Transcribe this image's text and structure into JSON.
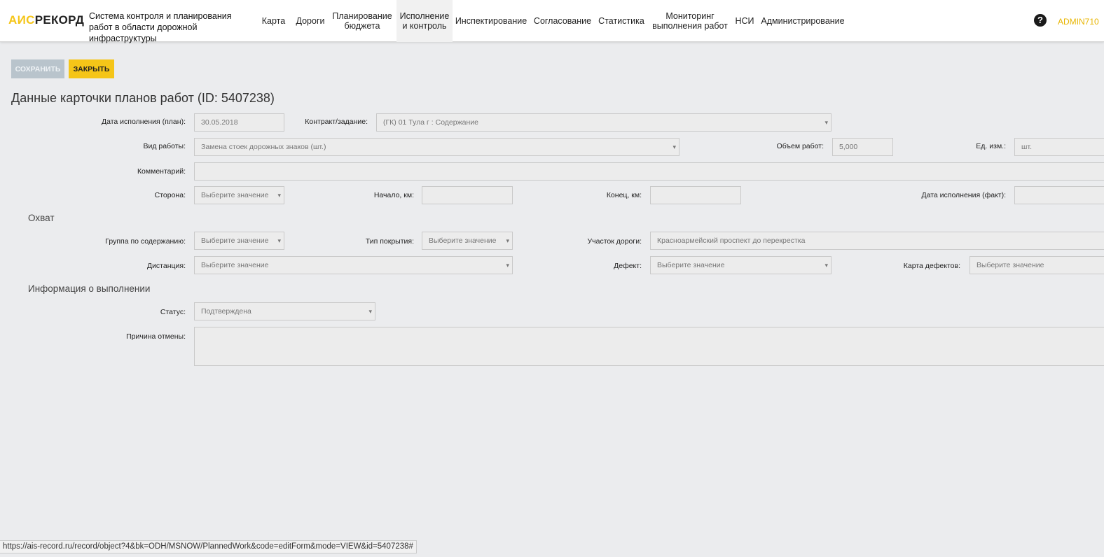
{
  "header": {
    "logo_part1": "АИС",
    "logo_part2": "РЕКОРД",
    "app_title": "Система контроля и планирования работ в области дорожной инфраструктуры",
    "nav": [
      {
        "label": "Карта"
      },
      {
        "label": "Дороги"
      },
      {
        "label": "Планирование\nбюджета"
      },
      {
        "label": "Исполнение\nи контроль",
        "active": true
      },
      {
        "label": "Инспектирование"
      },
      {
        "label": "Согласование"
      },
      {
        "label": "Статистика"
      },
      {
        "label": "Мониторинг\nвыполнения работ"
      },
      {
        "label": "НСИ"
      },
      {
        "label": "Администрирование"
      }
    ],
    "help_icon": "question-circle-icon",
    "help_glyph": "?",
    "user": "ADMIN710"
  },
  "toolbar": {
    "save_label": "СОХРАНИТЬ",
    "close_label": "ЗАКРЫТЬ"
  },
  "page_title": "Данные карточки планов работ (ID: 5407238)",
  "form": {
    "plan_date": {
      "label": "Дата исполнения (план):",
      "value": "30.05.2018"
    },
    "contract": {
      "label": "Контракт/задание:",
      "value": "(ГК) 01 Тула г : Содержание"
    },
    "work_type": {
      "label": "Вид работы:",
      "value": "Замена стоек дорожных знаков (шт.)"
    },
    "volume": {
      "label": "Объем работ:",
      "value": "5,000"
    },
    "unit": {
      "label": "Ед. изм.:",
      "value": "шт."
    },
    "comment": {
      "label": "Комментарий:",
      "value": ""
    },
    "side": {
      "label": "Сторона:",
      "value": "Выберите значение"
    },
    "start_km": {
      "label": "Начало, км:",
      "value": ""
    },
    "end_km": {
      "label": "Конец, км:",
      "value": ""
    },
    "fact_date": {
      "label": "Дата исполнения (факт):",
      "value": ""
    }
  },
  "coverage": {
    "title": "Охват",
    "group": {
      "label": "Группа по содержанию:",
      "value": "Выберите значение"
    },
    "surface": {
      "label": "Тип покрытия:",
      "value": "Выберите значение"
    },
    "road_section": {
      "label": "Участок дороги:",
      "value": "Красноармейский проспект до перекрестка"
    },
    "distance": {
      "label": "Дистанция:",
      "value": "Выберите значение"
    },
    "defect": {
      "label": "Дефект:",
      "value": "Выберите значение"
    },
    "defect_map": {
      "label": "Карта дефектов:",
      "value": "Выберите значение"
    }
  },
  "execution": {
    "title": "Информация о выполнении",
    "status": {
      "label": "Статус:",
      "value": "Подтверждена"
    },
    "cancel_reason": {
      "label": "Причина отмены:",
      "value": ""
    }
  },
  "status_url": "https://ais-record.ru/record/object?4&bk=ODH/MSNOW/PlannedWork&code=editForm&mode=VIEW&id=5407238#"
}
